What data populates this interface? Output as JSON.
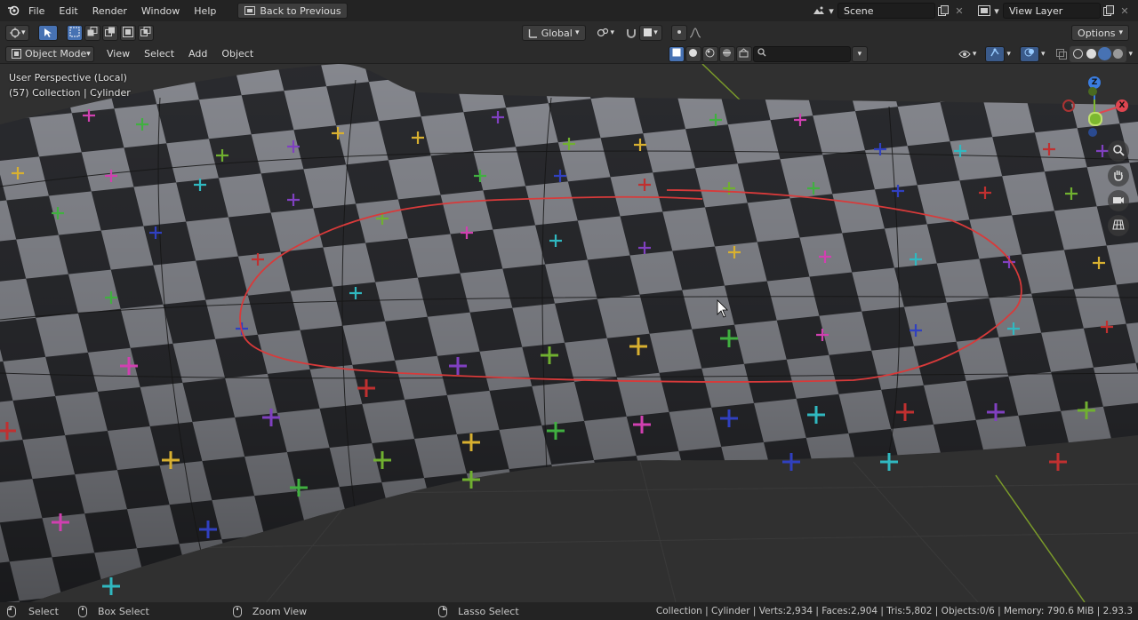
{
  "topbar": {
    "menus": [
      "File",
      "Edit",
      "Render",
      "Window",
      "Help"
    ],
    "back_button": "Back to Previous",
    "scene": "Scene",
    "view_layer": "View Layer"
  },
  "toolbar": {
    "transform_orientation": "Global",
    "options": "Options"
  },
  "header": {
    "mode": "Object Mode",
    "menus": [
      "View",
      "Select",
      "Add",
      "Object"
    ]
  },
  "viewport": {
    "perspective": "User Perspective (Local)",
    "collection": "(57) Collection | Cylinder",
    "gizmo": {
      "z": "Z",
      "x": "X",
      "y": "Y"
    }
  },
  "statusbar": {
    "select": "Select",
    "box_select": "Box Select",
    "zoom_view": "Zoom View",
    "lasso_select": "Lasso Select",
    "stats": "Collection | Cylinder | Verts:2,934 | Faces:2,904 | Tris:5,802 | Objects:0/6 | Memory: 790.6 MiB | 2.93.3"
  },
  "colors": {
    "accent": "#4772b3",
    "annotation": "#d83a3a",
    "x_axis": "#e04550",
    "y_axis": "#7cb82f",
    "z_axis": "#3a7de0"
  }
}
